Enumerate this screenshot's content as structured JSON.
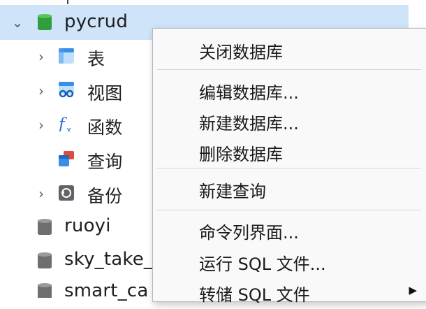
{
  "tree": {
    "selected_db": {
      "label": "pycrud"
    },
    "children": [
      {
        "label": "表",
        "icon": "table-icon"
      },
      {
        "label": "视图",
        "icon": "view-icon"
      },
      {
        "label": "函数",
        "icon": "function-icon"
      },
      {
        "label": "查询",
        "icon": "query-icon"
      },
      {
        "label": "备份",
        "icon": "backup-icon"
      }
    ],
    "databases": [
      {
        "label": "ruoyi"
      },
      {
        "label": "sky_take_"
      },
      {
        "label": "smart_ca"
      }
    ]
  },
  "context_menu": {
    "items": [
      {
        "label": "关闭数据库"
      },
      {
        "label": "编辑数据库..."
      },
      {
        "label": "新建数据库..."
      },
      {
        "label": "删除数据库"
      },
      {
        "label": "新建查询"
      },
      {
        "label": "命令列界面..."
      },
      {
        "label": "运行 SQL 文件..."
      },
      {
        "label": "转储 SQL 文件"
      }
    ]
  },
  "colors": {
    "db_active": "#3daa3d",
    "db_inactive": "#707070",
    "selection": "#cfe4f9",
    "menu_bg": "#f9f9f9"
  }
}
